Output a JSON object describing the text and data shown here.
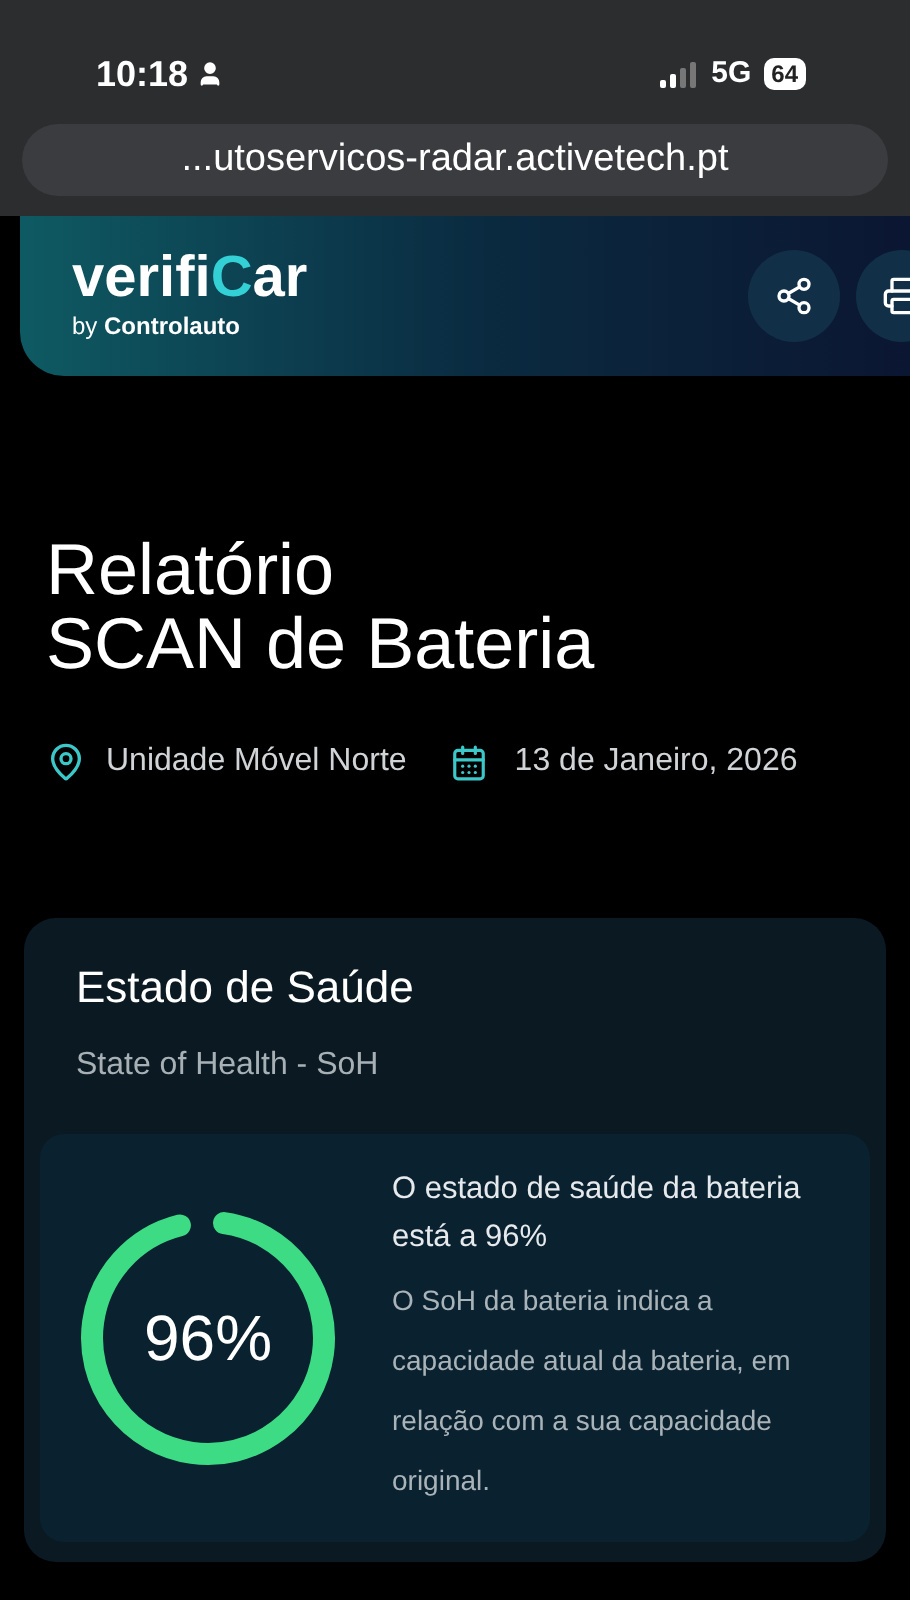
{
  "status_bar": {
    "time": "10:18",
    "network": "5G",
    "battery": "64"
  },
  "browser": {
    "url": "...utoservicos-radar.activetech.pt"
  },
  "header": {
    "logo": {
      "name_start": "verifi",
      "name_accent": "C",
      "name_end": "ar",
      "tagline": "by **Controlauto**"
    }
  },
  "report": {
    "title_lines": [
      "Relatório",
      "SCAN de Bateria"
    ],
    "location": "Unidade Móvel Norte",
    "date": "13 de Janeiro, 2026"
  },
  "health_card": {
    "title": "Estado de Saúde",
    "subtitle": "State of Health - SoH",
    "gauge": {
      "level": 0.96,
      "reading": "96%"
    },
    "headline": "O estado de saúde da bateria está a 96%",
    "description": "O SoH da bateria indica a capacidade atual da bateria, em relação com a sua capacidade original."
  }
}
